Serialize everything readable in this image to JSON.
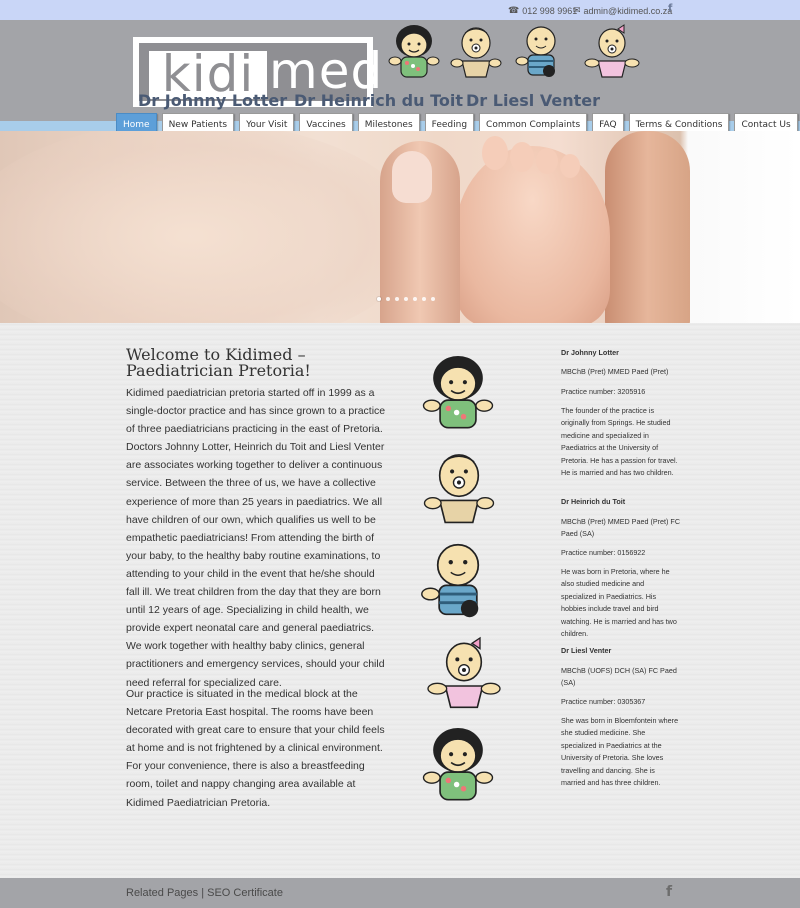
{
  "topbar": {
    "phone": "012 998 9961",
    "email": "admin@kidimed.co.za",
    "facebook_icon": "facebook-icon"
  },
  "logo": {
    "part1": "kidi",
    "part2": "med"
  },
  "doctors_header": [
    "Dr Johnny Lotter",
    "Dr Heinrich du Toit",
    "Dr Liesl Venter"
  ],
  "nav": {
    "items": [
      "Home",
      "New Patients",
      "Your Visit",
      "Vaccines",
      "Milestones",
      "Feeding",
      "Common Complaints",
      "FAQ",
      "Terms & Conditions",
      "Contact Us"
    ],
    "active": "Home"
  },
  "hero": {
    "slide_count": 7,
    "active_slide": 1
  },
  "main": {
    "title": "Welcome to Kidimed – Paediatrician Pretoria!",
    "para1": "Kidimed paediatrician pretoria started off in 1999 as a single-doctor practice and has since grown to a practice of three paediatricians practicing in the east of Pretoria. Doctors Johnny Lotter, Heinrich du Toit and Liesl Venter are associates working together to deliver a continuous service. Between the three of us, we have a collective experience of more than 25 years in paediatrics. We all have children of our own, which qualifies us well to be empathetic paediatricians! From attending the birth of your baby, to the healthy baby routine examinations, to attending to your child in the event that he/she should fall ill. We treat children from the day that they are born until 12 years of age. Specializing in child health, we provide expert neonatal care and general paediatrics. We work together with healthy baby clinics, general practitioners and emergency services, should your child need referral for specialized care.",
    "para2": "Our practice is situated in the medical block at the Netcare Pretoria East hospital. The rooms have been decorated with great care to ensure that your child feels at home and is not frightened by a clinical environment. For your convenience, there is also a breastfeeding room, toilet and nappy changing area available at Kidimed Paediatrician Pretoria."
  },
  "sidebar": {
    "doctors": [
      {
        "name": "Dr Johnny Lotter",
        "qual": "MBChB (Pret) MMED Paed (Pret)",
        "practice": "Practice number: 3205916",
        "bio": "The founder of the practice is originally from Springs.  He studied medicine and specialized in Paediatrics at the University of Pretoria.  He has a passion for travel.  He is married and has two children."
      },
      {
        "name": "Dr Heinrich du Toit",
        "qual": "MBChB (Pret) MMED Paed (Pret) FC Paed (SA)",
        "practice": "Practice number: 0156922",
        "bio": "He was born in Pretoria, where he also studied medicine and specialized in Paediatrics.  His hobbies include travel and bird watching.  He is married and has two children."
      },
      {
        "name": "Dr Liesl Venter",
        "qual": "MBChB (UOFS) DCH (SA) FC Paed (SA)",
        "practice": "Practice number: 0305367",
        "bio": "She was born in Bloemfontein where she studied medicine.  She specialized in Paediatrics at the University of Pretoria.  She loves travelling and dancing.  She is married and has three children."
      }
    ]
  },
  "footer": {
    "links": "Related Pages | SEO Certificate",
    "facebook_icon": "facebook-icon"
  },
  "colors": {
    "topbar_bg": "#c9d6f7",
    "header_bg": "#a3a4a8",
    "nav_active": "#5d9fd9",
    "accent_strip": "#a8cdea"
  }
}
